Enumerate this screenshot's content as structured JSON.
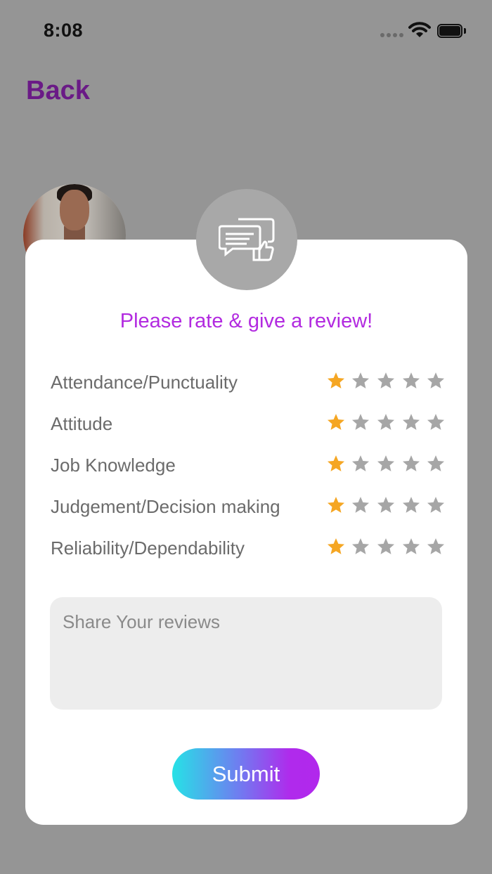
{
  "status_bar": {
    "time": "8:08"
  },
  "nav": {
    "back_label": "Back"
  },
  "dialog": {
    "title": "Please rate & give a review!",
    "max_stars": 5,
    "ratings": [
      {
        "label": "Attendance/Punctuality",
        "value": 1
      },
      {
        "label": "Attitude",
        "value": 1
      },
      {
        "label": "Job Knowledge",
        "value": 1
      },
      {
        "label": "Judgement/Decision making",
        "value": 1
      },
      {
        "label": "Reliability/Dependability",
        "value": 1
      }
    ],
    "review_placeholder": "Share Your reviews",
    "review_value": "",
    "submit_label": "Submit"
  },
  "colors": {
    "overlay_bg": "#959595",
    "back_text": "#6a1a86",
    "title_text": "#b22ae0",
    "star_active": "#f5a623",
    "star_inactive": "#a6a6a6",
    "submit_gradient": [
      "#26e2e6",
      "#b02aec"
    ]
  },
  "icons": {
    "badge": "review-thumbs-up-icon",
    "star": "star-icon",
    "wifi": "wifi-icon",
    "battery": "battery-icon"
  }
}
